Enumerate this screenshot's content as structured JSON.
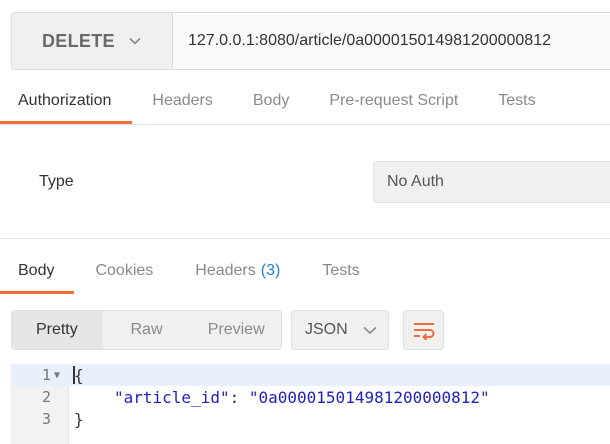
{
  "request": {
    "method": "DELETE",
    "url": "127.0.0.1:8080/article/0a000015014981200000812"
  },
  "request_tabs": [
    {
      "label": "Authorization",
      "active": true
    },
    {
      "label": "Headers",
      "active": false
    },
    {
      "label": "Body",
      "active": false
    },
    {
      "label": "Pre-request Script",
      "active": false
    },
    {
      "label": "Tests",
      "active": false
    }
  ],
  "auth": {
    "type_label": "Type",
    "type_value": "No Auth"
  },
  "response_tabs": {
    "body": "Body",
    "cookies": "Cookies",
    "headers": "Headers",
    "headers_count": "(3)",
    "tests": "Tests"
  },
  "view_modes": [
    "Pretty",
    "Raw",
    "Preview"
  ],
  "format": "JSON",
  "code": {
    "line_numbers": [
      "1",
      "2",
      "3"
    ],
    "open_brace": "{",
    "key": "\"article_id\"",
    "colon": ": ",
    "value": "\"0a000015014981200000812\"",
    "close_brace": "}"
  },
  "colors": {
    "accent": "#f26b3a",
    "link": "#1f7fd1",
    "json_string": "#1f1fbf"
  },
  "icons": {
    "method_dropdown": "chevron-down-icon",
    "format_dropdown": "chevron-down-icon",
    "wrap": "wrap-lines-icon",
    "fold": "fold-caret-icon"
  }
}
